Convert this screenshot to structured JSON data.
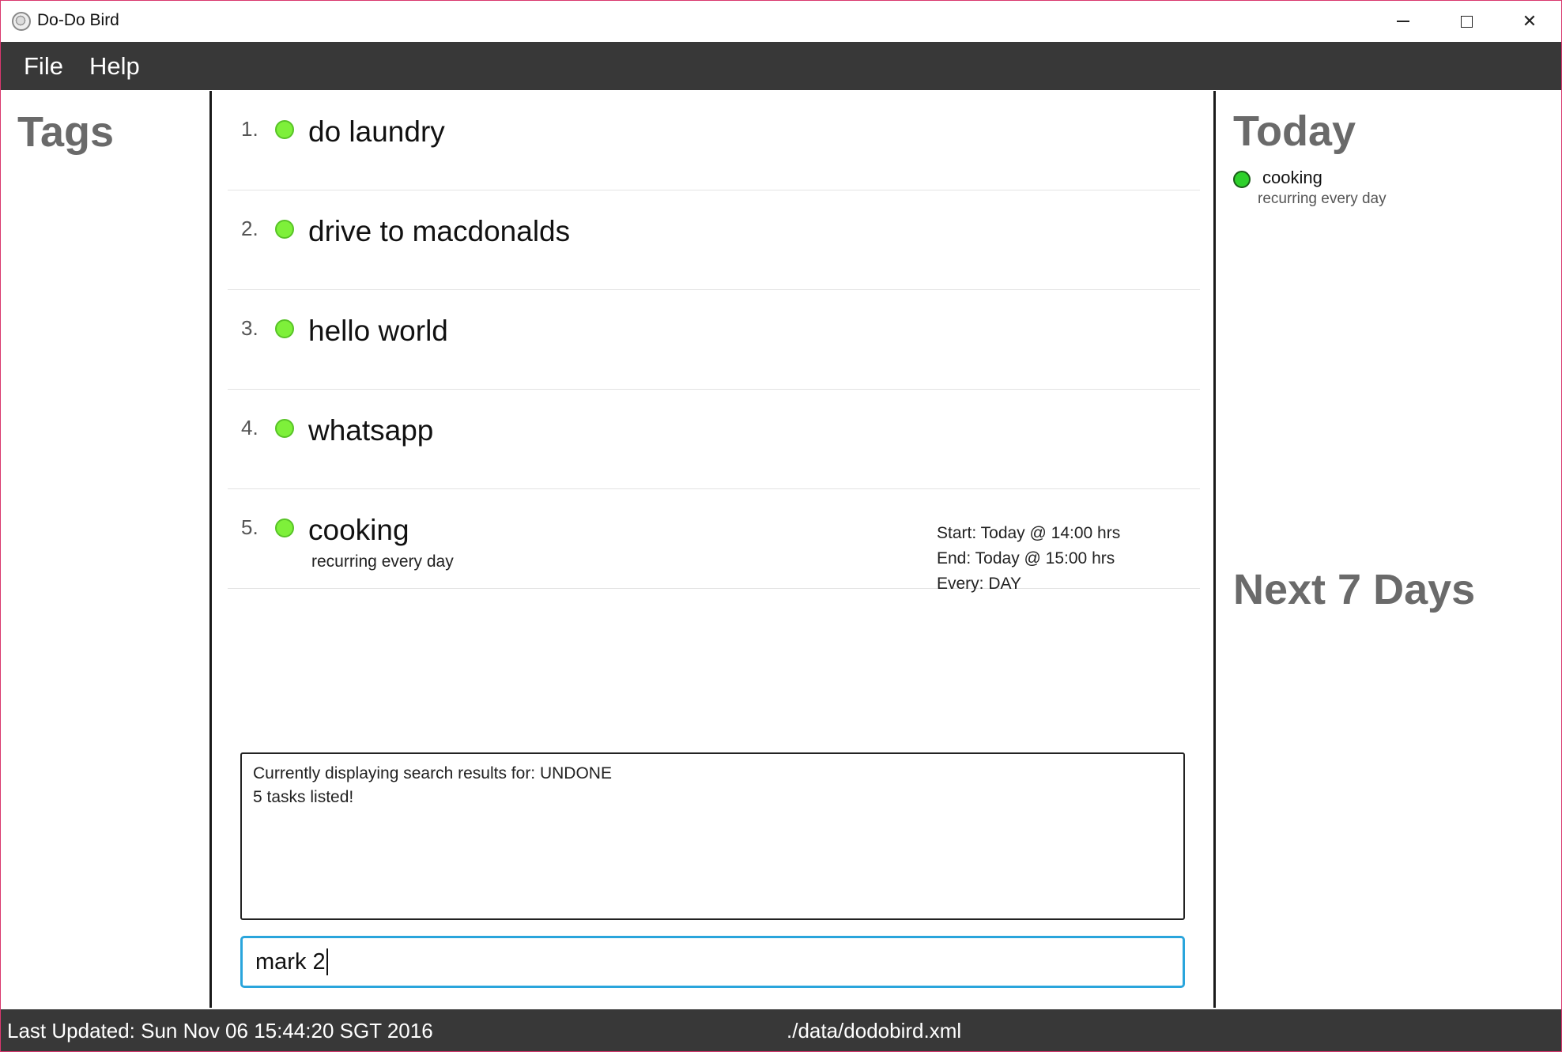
{
  "window": {
    "title": "Do-Do Bird"
  },
  "menu": {
    "items": [
      "File",
      "Help"
    ]
  },
  "tags_panel": {
    "title": "Tags"
  },
  "tasks": [
    {
      "number": "1.",
      "name": "do laundry",
      "subtitle": "",
      "start": "",
      "end": "",
      "every": ""
    },
    {
      "number": "2.",
      "name": "drive to macdonalds",
      "subtitle": "",
      "start": "",
      "end": "",
      "every": ""
    },
    {
      "number": "3.",
      "name": "hello world",
      "subtitle": "",
      "start": "",
      "end": "",
      "every": ""
    },
    {
      "number": "4.",
      "name": "whatsapp",
      "subtitle": "",
      "start": "",
      "end": "",
      "every": ""
    },
    {
      "number": "5.",
      "name": "cooking",
      "subtitle": "recurring every day",
      "start": "Start: Today @ 14:00 hrs",
      "end": "End: Today @ 15:00 hrs",
      "every": "Every: DAY"
    }
  ],
  "result": {
    "line1": "Currently displaying search results for: UNDONE",
    "line2": "5 tasks listed!"
  },
  "command": {
    "value": "mark 2"
  },
  "today_panel": {
    "title": "Today",
    "items": [
      {
        "name": "cooking",
        "subtitle": "recurring every day"
      }
    ]
  },
  "next_panel": {
    "title": "Next 7 Days"
  },
  "status": {
    "last_updated": "Last Updated: Sun Nov 06 15:44:20 SGT 2016",
    "file_path": "./data/dodobird.xml"
  },
  "colors": {
    "task_dot": "#7ef03a",
    "today_dot": "#2ed02b",
    "bar_bg": "#383838",
    "command_border": "#2aa5dc"
  }
}
